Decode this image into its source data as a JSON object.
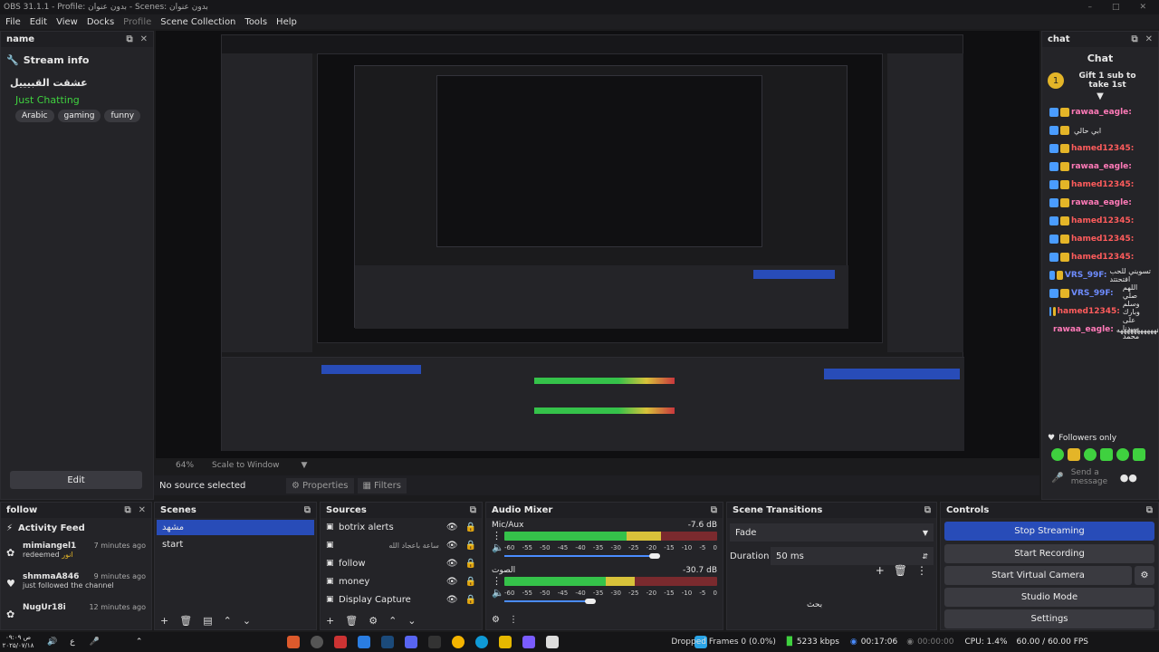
{
  "window": {
    "title": "OBS 31.1.1 - Profile: بدون عنوان - Scenes: بدون عنوان"
  },
  "menu": [
    "File",
    "Edit",
    "View",
    "Docks",
    "Profile",
    "Scene Collection",
    "Tools",
    "Help"
  ],
  "left_dock": {
    "title": "name",
    "stream_info_label": "Stream info",
    "channel_title": "عشقت القبيييل",
    "category": "Just Chatting",
    "tags": [
      "Arabic",
      "gaming",
      "funny"
    ],
    "edit_button": "Edit"
  },
  "chat_dock": {
    "title": "chat",
    "header": "Chat",
    "gift_text": "Gift 1 sub to take 1st",
    "messages": [
      {
        "user": "rawaa_eagle:",
        "color": "#ff7ab8",
        "text": ""
      },
      {
        "user": "",
        "color": "#ff7ab8",
        "text": "ابي حالي"
      },
      {
        "user": "hamed12345:",
        "color": "#ff5c5c",
        "text": ""
      },
      {
        "user": "rawaa_eagle:",
        "color": "#ff7ab8",
        "text": ""
      },
      {
        "user": "hamed12345:",
        "color": "#ff5c5c",
        "text": ""
      },
      {
        "user": "rawaa_eagle:",
        "color": "#ff7ab8",
        "text": ""
      },
      {
        "user": "hamed12345:",
        "color": "#ff5c5c",
        "text": ""
      },
      {
        "user": "hamed12345:",
        "color": "#ff5c5c",
        "text": ""
      },
      {
        "user": "hamed12345:",
        "color": "#ff5c5c",
        "text": ""
      },
      {
        "user": "VRS_99F:",
        "color": "#6e8cff",
        "text": "تسويني للحب افتحتتد"
      },
      {
        "user": "VRS_99F:",
        "color": "#6e8cff",
        "text": ""
      },
      {
        "user": "hamed12345:",
        "color": "#ff5c5c",
        "text": "اللهم صلي وسلم وبارك على سيدنا محمد"
      },
      {
        "user": "rawaa_eagle:",
        "color": "#ff7ab8",
        "text": "ههههههههههههه"
      }
    ],
    "followers_only": "Followers only",
    "send_placeholder": "Send a message"
  },
  "preview": {
    "zoom": "64%",
    "scale_mode": "Scale to Window"
  },
  "source_bar": {
    "no_source": "No source selected",
    "properties": "Properties",
    "filters": "Filters"
  },
  "follow_dock": {
    "title": "follow",
    "feed_title": "Activity Feed",
    "items": [
      {
        "user": "mimiangel1",
        "action": "redeemed",
        "extra": "انور",
        "time": "7 minutes ago"
      },
      {
        "user": "shmmaA846",
        "action": "just followed the channel",
        "extra": "",
        "time": "9 minutes ago"
      },
      {
        "user": "NugUr18i",
        "action": "",
        "extra": "",
        "time": "12 minutes ago"
      }
    ]
  },
  "scenes_dock": {
    "title": "Scenes",
    "items": [
      "مشهد",
      "start"
    ],
    "selected": 0
  },
  "sources_dock": {
    "title": "Sources",
    "items": [
      "botrix alerts",
      "ساعة باعجاد الله",
      "follow",
      "money",
      "Display Capture"
    ]
  },
  "audio_dock": {
    "title": "Audio Mixer",
    "tracks": [
      {
        "name": "Mic/Aux",
        "db": "-7.6 dB"
      },
      {
        "name": "الصوت",
        "db": "-30.7 dB"
      }
    ],
    "ticks": [
      "-60",
      "-55",
      "-50",
      "-45",
      "-40",
      "-35",
      "-30",
      "-25",
      "-20",
      "-15",
      "-10",
      "-5",
      "0"
    ]
  },
  "transitions_dock": {
    "title": "Scene Transitions",
    "transition": "Fade",
    "duration_label": "Duration",
    "duration_value": "50 ms",
    "floating_text": "بحث"
  },
  "controls_dock": {
    "title": "Controls",
    "buttons": [
      "Stop Streaming",
      "Start Recording",
      "Start Virtual Camera",
      "Studio Mode",
      "Settings"
    ]
  },
  "status_bar": {
    "dropped": "Dropped Frames 0 (0.0%)",
    "bitrate": "5233 kbps",
    "stream_time": "00:17:06",
    "rec_time": "00:00:00",
    "cpu": "CPU: 1.4%",
    "fps": "60.00 / 60.00 FPS",
    "clock_time": "۰۹:۰۹ ص",
    "clock_date": "۲۰۲۵/۰۷/۱۸",
    "lang": "ع"
  },
  "colors": {
    "accent_blue": "#284cb8",
    "category_green": "#3fd13f",
    "meter_green": "#35c24a",
    "meter_yellow": "#d8c23a",
    "meter_red": "#c9373d"
  }
}
